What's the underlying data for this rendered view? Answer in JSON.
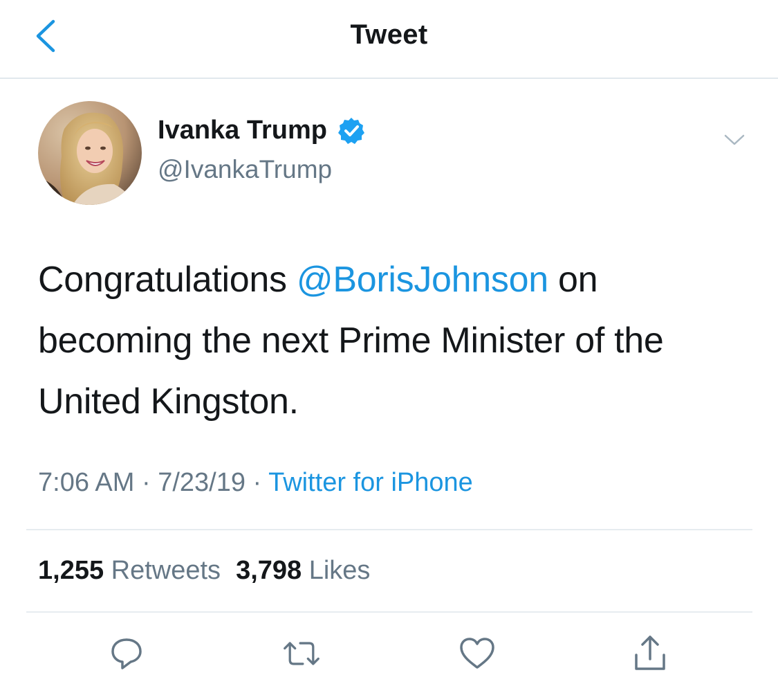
{
  "header": {
    "title": "Tweet",
    "back_icon": "chevron-left-icon"
  },
  "author": {
    "name": "Ivanka Trump",
    "handle": "@IvankaTrump",
    "verified": true,
    "verified_icon": "verified-badge-icon",
    "avatar_icon": "profile-photo"
  },
  "tweet": {
    "text_before": "Congratulations ",
    "mention": "@BorisJohnson",
    "text_after": " on becoming the next Prime Minister of the United Kingston."
  },
  "meta": {
    "time": "7:06 AM",
    "separator": " · ",
    "date": "7/23/19",
    "source": "Twitter for iPhone"
  },
  "stats": {
    "retweets_count": "1,255",
    "retweets_label": "Retweets",
    "likes_count": "3,798",
    "likes_label": "Likes"
  },
  "actions": [
    "reply-icon",
    "retweet-icon",
    "like-icon",
    "share-icon"
  ],
  "colors": {
    "accent": "#1b95e0",
    "text_primary": "#14171a",
    "text_secondary": "#657786",
    "divider": "#e6ecf0"
  }
}
